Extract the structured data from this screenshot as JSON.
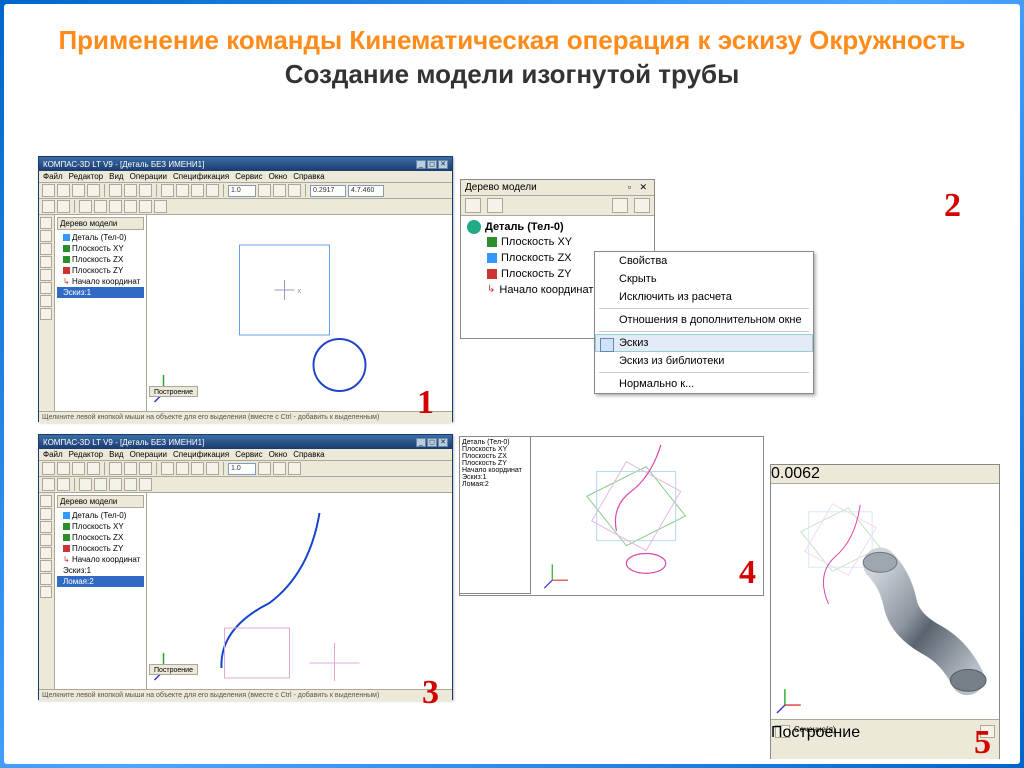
{
  "title": {
    "line1": "Применение команды Кинематическая операция к эскизу Окружность",
    "line2": "Создание модели изогнутой трубы"
  },
  "steps": {
    "s1": "1",
    "s2": "2",
    "s3": "3",
    "s4": "4",
    "s5": "5"
  },
  "cad": {
    "app_title": "КОМПАС-3D LT V9 - [Деталь БЕЗ ИМЕНИ1]",
    "menus": [
      "Файл",
      "Редактор",
      "Вид",
      "Операции",
      "Спецификация",
      "Сервис",
      "Окно",
      "Справка"
    ],
    "field_x": "0.2917",
    "field_y": "4.7.460",
    "tree_title": "Дерево модели",
    "root": "Деталь (Тел-0)",
    "planes": [
      "Плоскость XY",
      "Плоскость ZX",
      "Плоскость ZY"
    ],
    "origin": "Начало координат",
    "sketch": "Эскиз:1",
    "curve": "Ломая:2",
    "tab_build": "Построение",
    "status": "Щелкните левой кнопкой мыши на объекте для его выделения (вместе с Ctrl - добавить к выделенным)"
  },
  "panel2": {
    "title": "Дерево модели",
    "pin": "✕",
    "root": "Деталь (Тел-0)",
    "children": [
      "Плоскость XY",
      "Плоскость ZX",
      "Плоскость ZY",
      "Начало координат"
    ]
  },
  "ctx": {
    "items_top": [
      "Свойства",
      "Скрыть",
      "Исключить из расчета"
    ],
    "items_mid": [
      "Отношения в дополнительном окне"
    ],
    "highlight": "Эскиз",
    "items_bot": [
      "Эскиз из библиотеки",
      "Нормально к..."
    ]
  },
  "panel5": {
    "tool_val": "0.0062",
    "bottom_tab": "Построение",
    "lower_label": "Сечение(я)"
  }
}
